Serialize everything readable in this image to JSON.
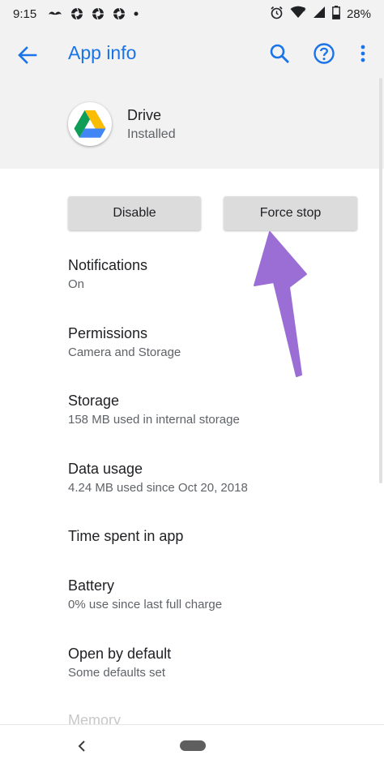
{
  "status_bar": {
    "time": "9:15",
    "battery": "28%"
  },
  "app_bar": {
    "title": "App info",
    "icons": [
      "back-arrow-icon",
      "search-icon",
      "help-icon",
      "more-vert-icon"
    ],
    "accent_color": "#1a73e8"
  },
  "app": {
    "name": "Drive",
    "status": "Installed",
    "icon": "google-drive-icon"
  },
  "buttons": {
    "disable": "Disable",
    "force_stop": "Force stop"
  },
  "items": [
    {
      "title": "Notifications",
      "subtitle": "On"
    },
    {
      "title": "Permissions",
      "subtitle": "Camera and Storage"
    },
    {
      "title": "Storage",
      "subtitle": "158 MB used in internal storage"
    },
    {
      "title": "Data usage",
      "subtitle": "4.24 MB used since Oct 20, 2018"
    },
    {
      "title": "Time spent in app",
      "subtitle": ""
    },
    {
      "title": "Battery",
      "subtitle": "0% use since last full charge"
    },
    {
      "title": "Open by default",
      "subtitle": "Some defaults set"
    }
  ],
  "faded_item": "Memory",
  "annotation": {
    "type": "arrow",
    "color": "#9b6ed6"
  }
}
